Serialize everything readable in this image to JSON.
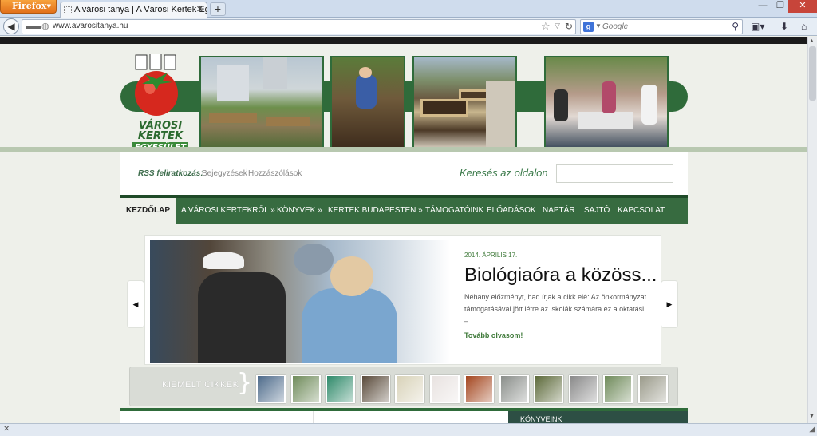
{
  "browser": {
    "menu_button": "Firefox",
    "tab_title": "A városi tanya | A Városi Kertek Egyesüle...",
    "url": "www.avarositanya.hu",
    "search_placeholder": "Google"
  },
  "logo": {
    "line1": "VÁROSI",
    "line2": "KERTEK",
    "line3": "EGYESÜLET"
  },
  "utility": {
    "rss_label": "RSS feliratkozás:",
    "rss_entries": "Bejegyzések",
    "rss_separator": "|",
    "rss_comments": "Hozzászólások",
    "search_label": "Keresés az oldalon",
    "search_value": ""
  },
  "menu": {
    "home": "KEZDŐLAP",
    "about": "A VÁROSI KERTEKRŐL »",
    "books": "KÖNYVEK »",
    "gardens": "KERTEK BUDAPESTEN »",
    "support": "TÁMOGATÓINK",
    "talks": "ELŐADÁSOK",
    "calendar": "NAPTÁR",
    "press": "SAJTÓ",
    "contact": "KAPCSOLAT"
  },
  "slide": {
    "date": "2014. ÁPRILIS 17.",
    "title": "Biológiaóra a közöss...",
    "excerpt": "Néhány előzményt, had írjak a cikk elé: Az önkormányzat támogatásával jött létre az iskolák számára ez a oktatási –...",
    "more": "Tovább olvasom!"
  },
  "featured": {
    "label": "KIEMELT CIKKEK",
    "thumb_colors": [
      "#4c6a8a",
      "#6f8b5a",
      "#2f8a6a",
      "#5a4a3a",
      "#d8d2b8",
      "#e8e2e0",
      "#a4461e",
      "#8a8e8a",
      "#5d6a3a",
      "#8a8a8a",
      "#6f8a5a",
      "#9a9a8a"
    ]
  },
  "sidebar": {
    "books_heading": "KÖNYVEINK"
  },
  "colors": {
    "brand_green": "#2f6b3a",
    "menu_green": "#376b40",
    "accent_text": "#3f7a3a"
  }
}
